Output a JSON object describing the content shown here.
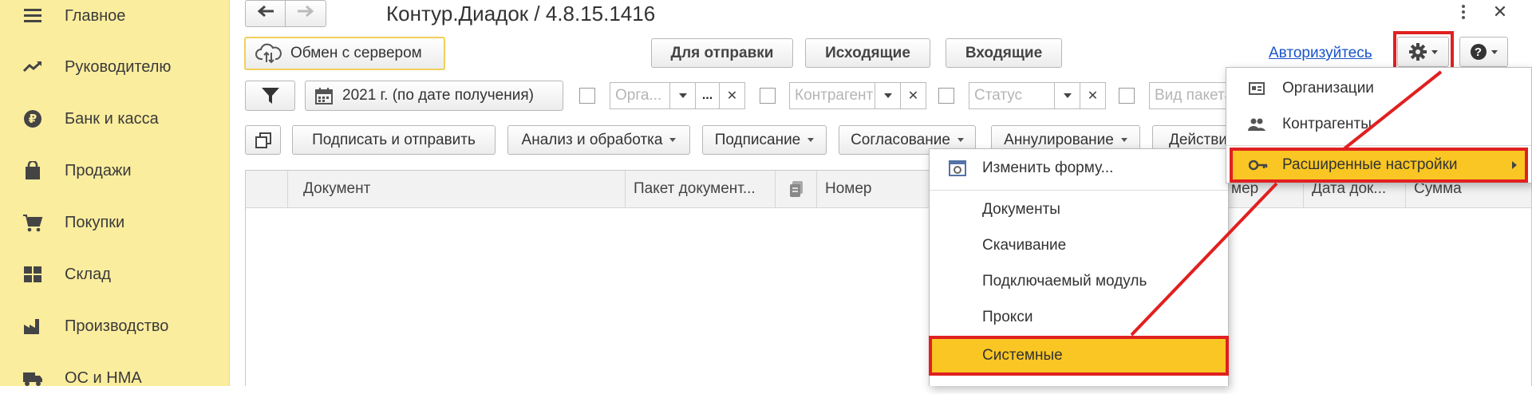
{
  "sidebar": {
    "items": [
      {
        "label": "Главное",
        "icon": "hamburger-icon"
      },
      {
        "label": "Руководителю",
        "icon": "trend-icon"
      },
      {
        "label": "Банк и касса",
        "icon": "ruble-icon"
      },
      {
        "label": "Продажи",
        "icon": "shopping-bag-icon"
      },
      {
        "label": "Покупки",
        "icon": "cart-icon"
      },
      {
        "label": "Склад",
        "icon": "warehouse-icon"
      },
      {
        "label": "Производство",
        "icon": "factory-icon"
      },
      {
        "label": "ОС и НМА",
        "icon": "truck-icon"
      }
    ]
  },
  "window": {
    "title": "Контур.Диадок / 4.8.15.1416"
  },
  "toolbar": {
    "exchange": "Обмен с сервером",
    "to_send": "Для отправки",
    "outgoing": "Исходящие",
    "incoming": "Входящие",
    "authorize": "Авторизуйтесь"
  },
  "filters": {
    "period": "2021 г. (по дате получения)",
    "org_placeholder": "Орга...",
    "org_more": "...",
    "contractor_placeholder": "Контрагент",
    "status_placeholder": "Статус",
    "package_placeholder": "Вид пакета"
  },
  "actions": {
    "sign_send": "Подписать и отправить",
    "analysis": "Анализ и обработка",
    "signing": "Подписание",
    "approval": "Согласование",
    "annulment": "Аннулирование",
    "more": "Действи"
  },
  "grid": {
    "columns": [
      "Документ",
      "Пакет документ...",
      "Номер",
      "мер",
      "Дата док...",
      "Сумма"
    ]
  },
  "settings_menu": {
    "items": [
      "Организации",
      "Контрагенты",
      "Расширенные настройки"
    ]
  },
  "submenu": {
    "change_form": "Изменить форму...",
    "items": [
      "Документы",
      "Скачивание",
      "Подключаемый модуль",
      "Прокси",
      "Системные"
    ]
  },
  "colors": {
    "sidebar": "#fbed9e",
    "highlight": "#f9c623",
    "annotation": "#e02020",
    "link": "#1a54c9"
  }
}
